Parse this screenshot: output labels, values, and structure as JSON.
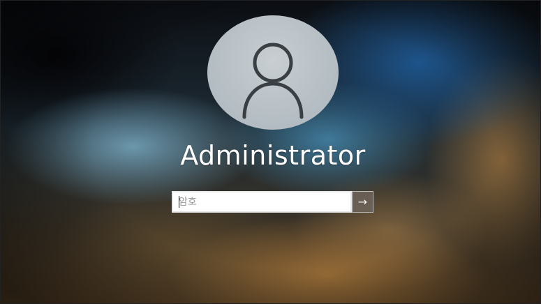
{
  "user": {
    "name": "Administrator",
    "avatar_icon": "user-silhouette-icon"
  },
  "password": {
    "placeholder": "암호",
    "value": ""
  },
  "submit": {
    "icon": "arrow-right-icon",
    "glyph": "→"
  },
  "colors": {
    "avatar_bg": "#b8c1c7",
    "avatar_line": "#3a3f44",
    "text": "#ffffff",
    "submit_bg": "#6e645a"
  }
}
